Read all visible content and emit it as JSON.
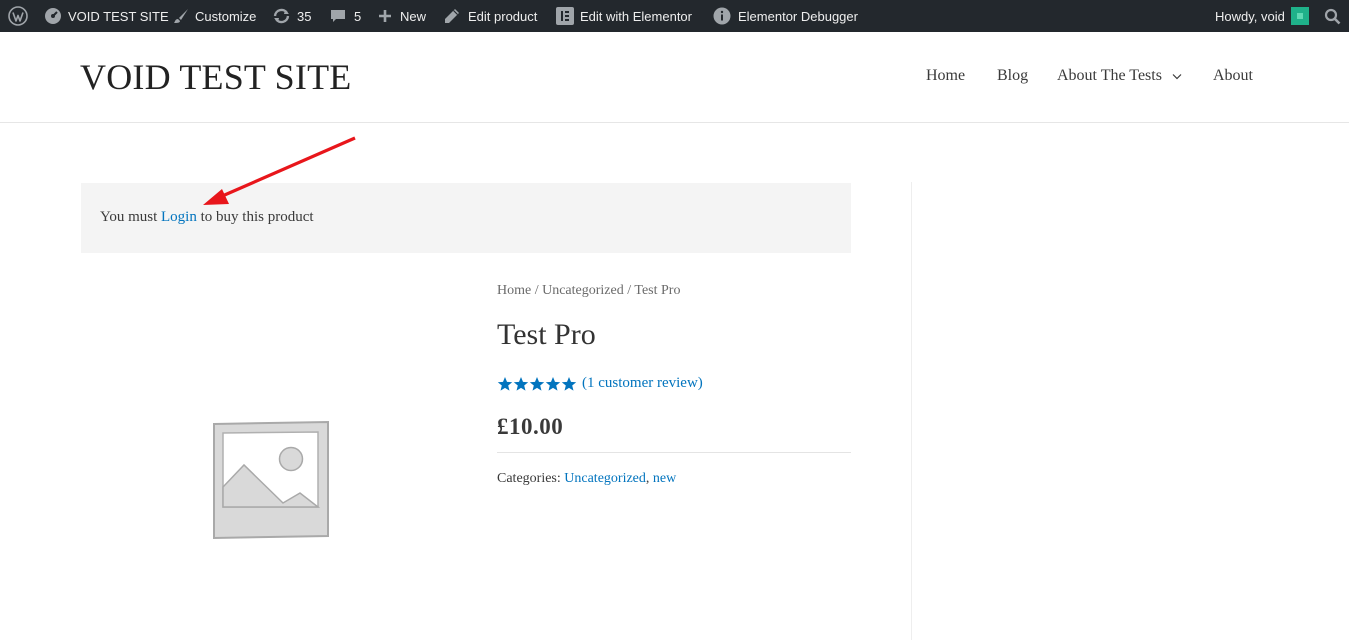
{
  "admin_bar": {
    "site_name": "VOID TEST SITE",
    "customize": "Customize",
    "updates_count": "35",
    "comments_count": "5",
    "new": "New",
    "edit_product": "Edit product",
    "edit_elementor": "Edit with Elementor",
    "debugger": "Elementor Debugger",
    "howdy": "Howdy, void"
  },
  "header": {
    "site_title": "VOID TEST SITE",
    "nav": [
      "Home",
      "Blog",
      "About The Tests",
      "About"
    ]
  },
  "notice": {
    "prefix": "You must",
    "link": "Login",
    "suffix": "to buy this product"
  },
  "product": {
    "breadcrumb": {
      "home": "Home",
      "sep": "/",
      "category": "Uncategorized",
      "current": "Test Pro"
    },
    "title": "Test Pro",
    "rating": 5,
    "rating_max": 5,
    "review_link": "(1 customer review)",
    "price": "£10.00",
    "categories_label": "Categories:",
    "categories": [
      "Uncategorized",
      "new"
    ]
  },
  "colors": {
    "link": "#0274be",
    "admin_bar_bg": "#23282d",
    "arrow": "#e8161b"
  },
  "icons": [
    "wordpress-icon",
    "dashboard-icon",
    "brush-icon",
    "updates-icon",
    "comment-icon",
    "plus-icon",
    "pencil-icon",
    "elementor-icon",
    "info-icon",
    "avatar",
    "search-icon",
    "chevron-down-icon",
    "star-icon",
    "image-placeholder-icon"
  ]
}
